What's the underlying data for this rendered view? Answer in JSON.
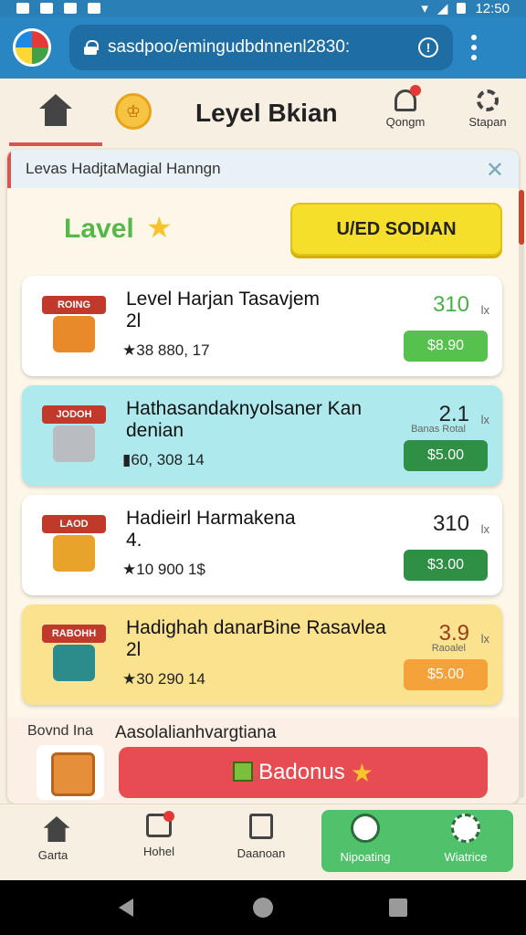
{
  "status_bar": {
    "time": "12:50"
  },
  "browser": {
    "url": "sasdpoo/emingudbdnnenl2830:"
  },
  "header": {
    "title": "Leyel Bkian",
    "coin_glyph": "♔",
    "notifications_label": "Qongm",
    "settings_label": "Stapan"
  },
  "panel": {
    "heading": "Levas HadjtaMagial Hanngn",
    "close_glyph": "✕",
    "level_label": "Lavel",
    "star_glyph": "★",
    "cta_label": "U/ED SODIAN"
  },
  "cards": [
    {
      "banner": "ROING",
      "title": "Level Harjan Tasavjem",
      "subtitle": "2l",
      "stats": "★38  880,  17",
      "value": "310",
      "unit": "lx",
      "sub_label": "",
      "price": "$8.90",
      "bg": "#ffffff",
      "value_color": "#48b04a",
      "button_color": "#57c14d",
      "box_color": "#e8892a"
    },
    {
      "banner": "JODOH",
      "title": "Hathasandaknyolsaner Kan",
      "subtitle": "denian",
      "stats": "▮60,  308   14",
      "value": "2.1",
      "unit": "lx",
      "sub_label": "Banas Rotal",
      "price": "$5.00",
      "bg": "#aee9ee",
      "value_color": "#222222",
      "button_color": "#2f8f44",
      "box_color": "#b9bdc2"
    },
    {
      "banner": "LAOD",
      "title": "Hadieirl Harmakena",
      "subtitle": "4.",
      "stats": "★10   900   1$",
      "value": "310",
      "unit": "lx",
      "sub_label": "",
      "price": "$3.00",
      "bg": "#ffffff",
      "value_color": "#222222",
      "button_color": "#2f8f44",
      "box_color": "#e8a32a"
    },
    {
      "banner": "RABOHH",
      "title": "Hadighah danarBine Rasavlea",
      "subtitle": "2l",
      "stats": "★30   290   14",
      "value": "3.9",
      "unit": "lx",
      "sub_label": "Raoalel",
      "price": "$5.00",
      "bg": "#fbe28e",
      "value_color": "#9a3b1c",
      "button_color": "#f5a23a",
      "box_color": "#2c8c8c"
    }
  ],
  "bottom_section": {
    "left_label": "Bovnd Ina",
    "right_label": "Aasolalianhvargtiana",
    "button_label": "Badonus",
    "button_star": "★"
  },
  "nav": [
    {
      "label": "Garta",
      "icon": "home-icon"
    },
    {
      "label": "Hohel",
      "icon": "camera-icon"
    },
    {
      "label": "Daanoan",
      "icon": "edit-icon"
    },
    {
      "label": "Nipoating",
      "icon": "badge-icon"
    },
    {
      "label": "Wiatrice",
      "icon": "gear-icon"
    }
  ]
}
